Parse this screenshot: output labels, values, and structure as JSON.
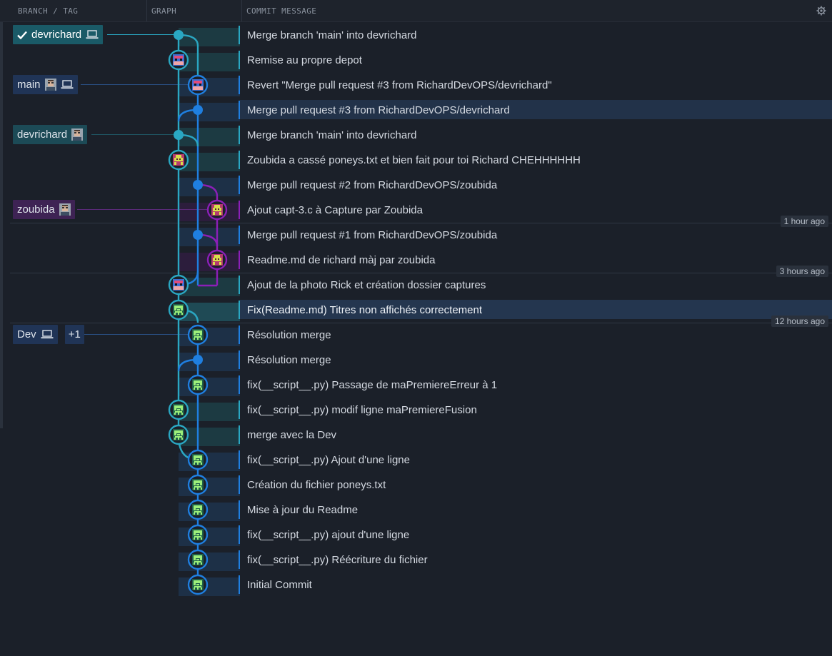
{
  "header": {
    "col_branch": "BRANCH / TAG",
    "col_graph": "GRAPH",
    "col_message": "COMMIT MESSAGE",
    "settings_icon": "gear-icon"
  },
  "colors": {
    "teal": "#2aa7c2",
    "blue": "#1f7fe0",
    "purple": "#8c1fb8",
    "background": "#1b2029",
    "selected_row": "#223249"
  },
  "time_markers": [
    {
      "label": "1 hour ago"
    },
    {
      "label": "3 hours ago"
    },
    {
      "label": "12 hours ago"
    }
  ],
  "refs": {
    "devrichard_local": {
      "label": "devrichard",
      "checked": true,
      "icon": "laptop-icon"
    },
    "main": {
      "label": "main",
      "icons": [
        "avatar-icon",
        "laptop-icon"
      ]
    },
    "devrichard_remote": {
      "label": "devrichard",
      "icon": "avatar-icon"
    },
    "zoubida": {
      "label": "zoubida",
      "icon": "avatar-icon"
    },
    "dev": {
      "label": "Dev",
      "icon": "laptop-icon",
      "extra": "+1"
    }
  },
  "commits": [
    {
      "message": "Merge branch 'main' into devrichard",
      "author_avatar": "none",
      "lane": "teal"
    },
    {
      "message": "Remise au propre depot",
      "author_avatar": "richard-avatar",
      "lane": "teal"
    },
    {
      "message": "Revert \"Merge pull request #3 from RichardDevOPS/devrichard\"",
      "author_avatar": "richard-avatar",
      "lane": "blue"
    },
    {
      "message": "Merge pull request #3 from RichardDevOPS/devrichard",
      "author_avatar": "none",
      "lane": "blue",
      "selected": true
    },
    {
      "message": "Merge branch 'main' into devrichard",
      "author_avatar": "none",
      "lane": "teal"
    },
    {
      "message": "Zoubida a cassé poneys.txt et bien fait pour toi Richard CHEHHHHHH",
      "author_avatar": "zoubida-avatar",
      "lane": "teal"
    },
    {
      "message": "Merge pull request #2 from RichardDevOPS/zoubida",
      "author_avatar": "none",
      "lane": "blue"
    },
    {
      "message": "Ajout capt-3.c à Capture par Zoubida",
      "author_avatar": "zoubida-avatar",
      "lane": "purple"
    },
    {
      "message": "Merge pull request #1 from RichardDevOPS/zoubida",
      "author_avatar": "none",
      "lane": "blue"
    },
    {
      "message": "Readme.md de richard màj par zoubida",
      "author_avatar": "zoubida-avatar",
      "lane": "purple"
    },
    {
      "message": "Ajout de la photo Rick et création dossier captures",
      "author_avatar": "richard-avatar",
      "lane": "teal"
    },
    {
      "message": "Fix(Readme.md) Titres non affichés correctement",
      "author_avatar": "green-avatar",
      "lane": "teal",
      "selected": true,
      "strong": true
    },
    {
      "message": "Résolution merge",
      "author_avatar": "green-avatar",
      "lane": "blue"
    },
    {
      "message": "Résolution merge",
      "author_avatar": "none",
      "lane": "blue"
    },
    {
      "message": "fix(__script__.py) Passage de maPremiereErreur à 1",
      "author_avatar": "green-avatar",
      "lane": "blue"
    },
    {
      "message": "fix(__script__.py) modif ligne maPremiereFusion",
      "author_avatar": "green-avatar",
      "lane": "teal"
    },
    {
      "message": "merge avec la Dev",
      "author_avatar": "green-avatar",
      "lane": "teal"
    },
    {
      "message": "fix(__script__.py) Ajout d'une ligne",
      "author_avatar": "green-avatar",
      "lane": "blue"
    },
    {
      "message": "Création du fichier poneys.txt",
      "author_avatar": "green-avatar",
      "lane": "blue"
    },
    {
      "message": "Mise à jour du Readme",
      "author_avatar": "green-avatar",
      "lane": "blue"
    },
    {
      "message": "fix(__script__.py) ajout d'une ligne",
      "author_avatar": "green-avatar",
      "lane": "blue"
    },
    {
      "message": "fix(__script__.py) Réécriture du fichier",
      "author_avatar": "green-avatar",
      "lane": "blue"
    },
    {
      "message": "Initial Commit",
      "author_avatar": "green-avatar",
      "lane": "blue"
    }
  ]
}
